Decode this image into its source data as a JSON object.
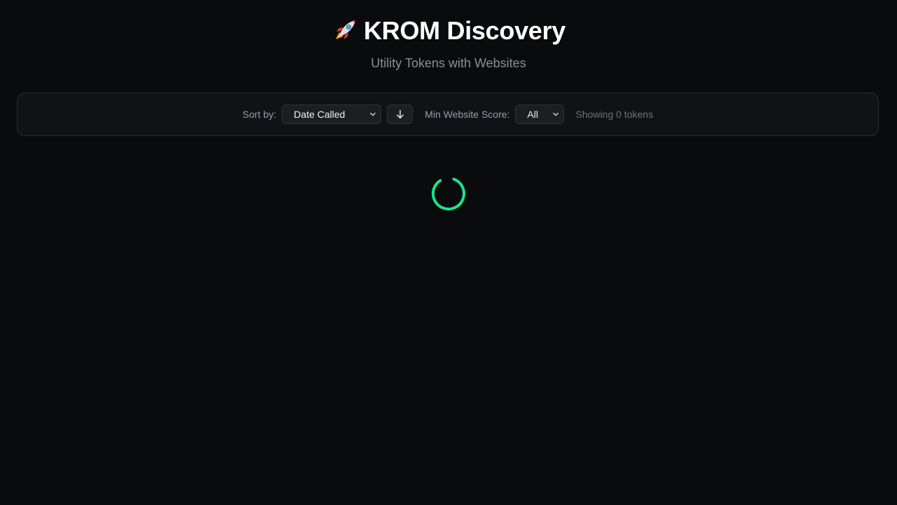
{
  "header": {
    "title": "KROM Discovery",
    "subtitle": "Utility Tokens with Websites",
    "title_icon": "rocket-icon"
  },
  "toolbar": {
    "sort_label": "Sort by:",
    "sort_value": "Date Called",
    "sort_direction_icon": "arrow-down-icon",
    "score_label": "Min Website Score:",
    "score_value": "All",
    "showing_text": "Showing 0 tokens"
  },
  "loading": {
    "icon": "loading-spinner-icon",
    "accent_color": "#19e58a"
  },
  "colors": {
    "background": "#0a0b0d",
    "panel": "#111215",
    "accent": "#19e58a"
  }
}
